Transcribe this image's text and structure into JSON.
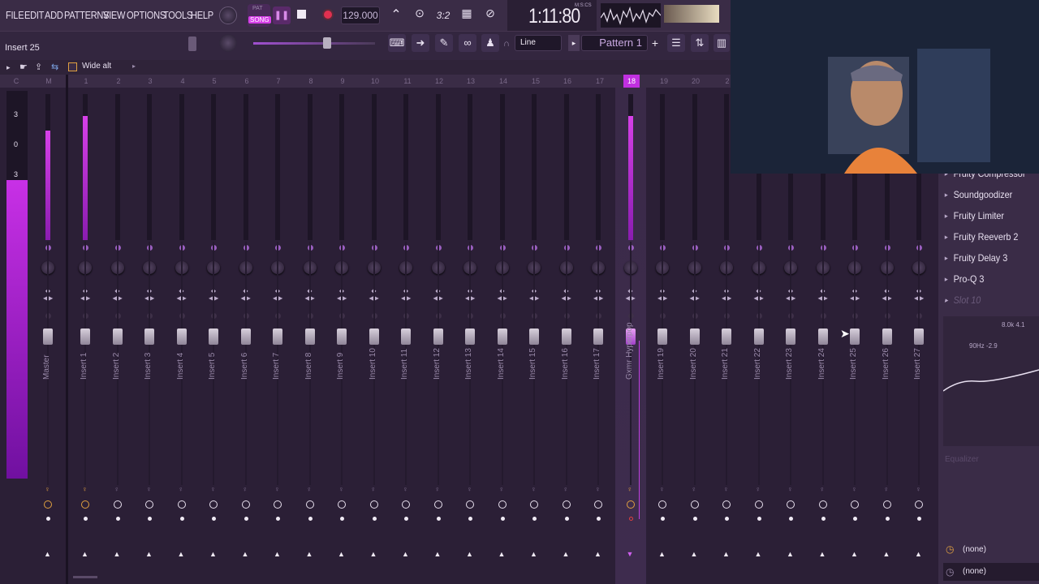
{
  "menu": [
    "FILE",
    "EDIT",
    "ADD",
    "PATTERNS",
    "VIEW",
    "OPTIONS",
    "TOOLS",
    "HELP"
  ],
  "transport": {
    "pat": "PAT",
    "song": "SONG",
    "tempo": "129.000",
    "time": "1:11:80",
    "time_unit": "M:S:CS"
  },
  "toolbar": {
    "hint": "Insert 25",
    "snap": "Line",
    "pattern": "Pattern 1",
    "preset": "Wide alt"
  },
  "master_scale": [
    "3",
    "0",
    "3"
  ],
  "track_numbers": [
    "C",
    "M",
    "1",
    "2",
    "3",
    "4",
    "5",
    "6",
    "7",
    "8",
    "9",
    "10",
    "11",
    "12",
    "13",
    "14",
    "15",
    "16",
    "17",
    "18",
    "19",
    "20",
    "2"
  ],
  "tracks": [
    {
      "name": "Master",
      "level": 0.75
    },
    {
      "name": "Insert 1",
      "level": 0.85
    },
    {
      "name": "Insert 2",
      "level": 0
    },
    {
      "name": "Insert 3",
      "level": 0
    },
    {
      "name": "Insert 4",
      "level": 0
    },
    {
      "name": "Insert 5",
      "level": 0
    },
    {
      "name": "Insert 6",
      "level": 0
    },
    {
      "name": "Insert 7",
      "level": 0
    },
    {
      "name": "Insert 8",
      "level": 0
    },
    {
      "name": "Insert 9",
      "level": 0
    },
    {
      "name": "Insert 10",
      "level": 0
    },
    {
      "name": "Insert 11",
      "level": 0
    },
    {
      "name": "Insert 12",
      "level": 0
    },
    {
      "name": "Insert 13",
      "level": 0
    },
    {
      "name": "Insert 14",
      "level": 0
    },
    {
      "name": "Insert 15",
      "level": 0
    },
    {
      "name": "Insert 16",
      "level": 0
    },
    {
      "name": "Insert 17",
      "level": 0
    },
    {
      "name": "Gxmr Hyperpop",
      "level": 0.85,
      "selected": true
    },
    {
      "name": "Insert 19",
      "level": 0
    },
    {
      "name": "Insert 20",
      "level": 0
    },
    {
      "name": "Insert 21",
      "level": 0
    },
    {
      "name": "Insert 22",
      "level": 0
    },
    {
      "name": "Insert 23",
      "level": 0
    },
    {
      "name": "Insert 24",
      "level": 0
    },
    {
      "name": "Insert 25",
      "level": 0
    },
    {
      "name": "Insert 26",
      "level": 0
    },
    {
      "name": "Insert 27",
      "level": 0
    }
  ],
  "fx_slots": [
    "Fruity Compressor",
    "Soundgoodizer",
    "Fruity Limiter",
    "Fruity Reeverb 2",
    "Fruity Delay 3",
    "Pro-Q 3",
    "Slot 10"
  ],
  "eq_preview": {
    "label_left": "90Hz -2.9",
    "label_right": "8.0k 4.1",
    "caption": "Equalizer"
  },
  "routing": {
    "in": "(none)",
    "out": "(none)"
  },
  "colors": {
    "accent": "#b52bd6",
    "bg": "#2b1f36"
  }
}
